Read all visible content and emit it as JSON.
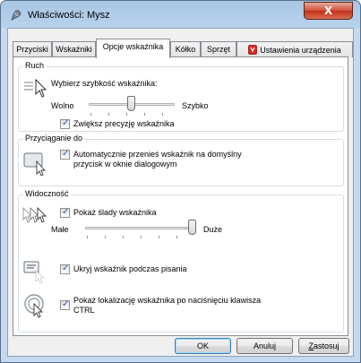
{
  "window": {
    "title": "Właściwości: Mysz",
    "close_glyph": "X"
  },
  "tabs": [
    {
      "label": "Przyciski"
    },
    {
      "label": "Wskaźniki"
    },
    {
      "label": "Opcje wskaźnika",
      "active": true
    },
    {
      "label": "Kółko"
    },
    {
      "label": "Sprzęt"
    },
    {
      "label": "Ustawienia urządzenia",
      "icon": "device-settings-icon"
    }
  ],
  "motion": {
    "group_label": "Ruch",
    "prompt": "Wybierz szybkość wskaźnika:",
    "slow_label": "Wolno",
    "fast_label": "Szybko",
    "speed_fraction": 0.5,
    "precision_label": "Zwiększ precyzję wskaźnika",
    "precision_checked": true
  },
  "snap": {
    "group_label": "Przyciąganie do",
    "label_line1": "Automatycznie przenieś wskaźnik na domyślny",
    "label_line2": "przycisk w oknie dialogowym",
    "checked": true
  },
  "visibility": {
    "group_label": "Widoczność",
    "trails_label": "Pokaż ślady wskaźnika",
    "trails_checked": true,
    "short_label": "Małe",
    "long_label": "Duże",
    "trail_fraction": 1.0,
    "hide_label": "Ukryj wskaźnik podczas pisania",
    "hide_checked": true,
    "ctrl_line1": "Pokaż lokalizację wskaźnika po naciśnięciu klawisza",
    "ctrl_line2": "CTRL",
    "ctrl_checked": true
  },
  "buttons": {
    "ok": "OK",
    "cancel": "Anuluj",
    "apply_first": "Z",
    "apply_rest": "astosuj"
  },
  "check_glyph": "✓"
}
